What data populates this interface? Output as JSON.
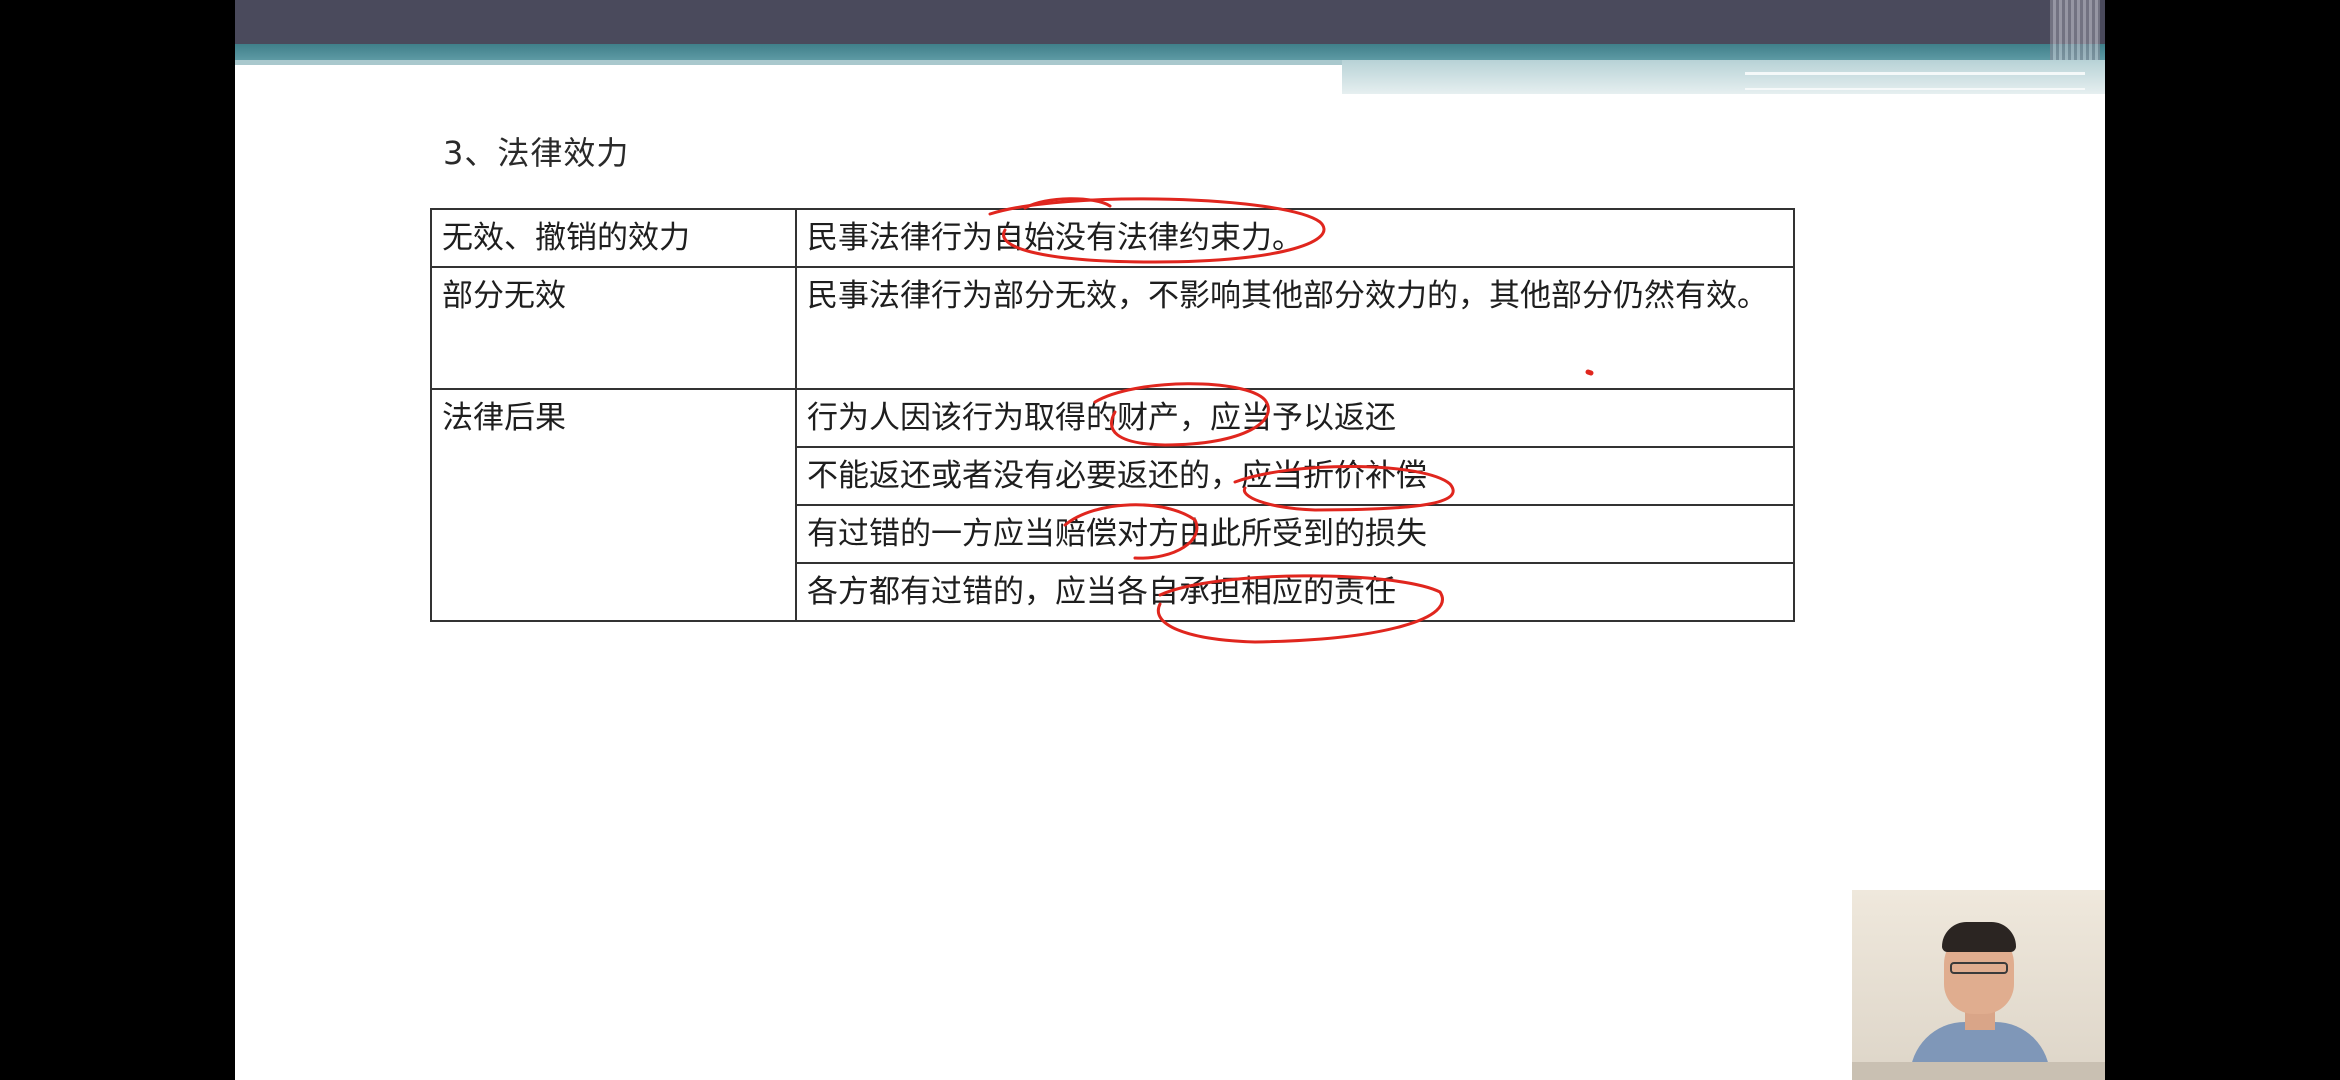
{
  "slide": {
    "title": "3、法律效力",
    "table": {
      "rows": [
        {
          "label": "无效、撤销的效力",
          "content": [
            "民事法律行为自始没有法律约束力。"
          ]
        },
        {
          "label": "部分无效",
          "content": [
            "民事法律行为部分无效，不影响其他部分效力的，其他部分仍然有效。"
          ]
        },
        {
          "label": "法律后果",
          "content": [
            "行为人因该行为取得的财产，应当予以返还",
            "不能返还或者没有必要返还的，应当折价补偿",
            "有过错的一方应当赔偿对方由此所受到的损失",
            "各方都有过错的，应当各自承担相应的责任"
          ]
        }
      ]
    }
  },
  "annotation_color": "#e0261e",
  "colors": {
    "header_band": "#4a4a5c",
    "teal_band": "#3f7f8a",
    "table_border": "#333333"
  }
}
